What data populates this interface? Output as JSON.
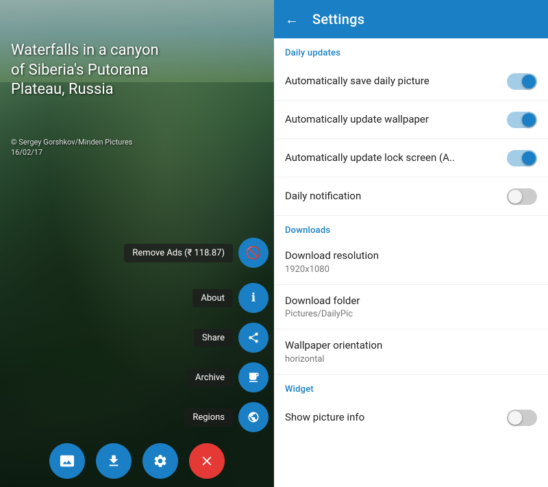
{
  "left": {
    "title": "Waterfalls in a canyon of Siberia's Putorana Plateau, Russia",
    "copyright": "© Sergey Gorshkov/Minden Pictures\n16/02/17",
    "remove_ads_label": "Remove Ads (₹ 118.87)",
    "fab_items": [
      {
        "label": "About",
        "icon": "ℹ"
      },
      {
        "label": "Share",
        "icon": "◁"
      },
      {
        "label": "Archive",
        "icon": "📅"
      },
      {
        "label": "Regions",
        "icon": "🌐"
      }
    ],
    "bottom_buttons": [
      {
        "name": "wallpaper-icon",
        "icon": "⊞",
        "color": "blue"
      },
      {
        "name": "download-icon",
        "icon": "↓",
        "color": "blue"
      },
      {
        "name": "settings-icon",
        "icon": "⚙",
        "color": "blue"
      },
      {
        "name": "close-icon",
        "icon": "✕",
        "color": "red"
      }
    ]
  },
  "right": {
    "header": {
      "back_label": "←",
      "title": "Settings"
    },
    "sections": [
      {
        "id": "daily-updates",
        "label": "Daily updates",
        "items": [
          {
            "id": "auto-save",
            "title": "Automatically save daily picture",
            "subtitle": "",
            "toggle": "on"
          },
          {
            "id": "auto-wallpaper",
            "title": "Automatically update wallpaper",
            "subtitle": "",
            "toggle": "on"
          },
          {
            "id": "auto-lock",
            "title": "Automatically update lock screen (A..",
            "subtitle": "",
            "toggle": "on"
          },
          {
            "id": "daily-notification",
            "title": "Daily notification",
            "subtitle": "",
            "toggle": "off"
          }
        ]
      },
      {
        "id": "downloads",
        "label": "Downloads",
        "items": [
          {
            "id": "download-resolution",
            "title": "Download resolution",
            "subtitle": "1920x1080",
            "toggle": null
          },
          {
            "id": "download-folder",
            "title": "Download folder",
            "subtitle": "Pictures/DailyPic",
            "toggle": null
          },
          {
            "id": "wallpaper-orientation",
            "title": "Wallpaper orientation",
            "subtitle": "horizontal",
            "toggle": null
          }
        ]
      },
      {
        "id": "widget",
        "label": "Widget",
        "items": [
          {
            "id": "show-picture-info",
            "title": "Show picture info",
            "subtitle": "",
            "toggle": "off"
          }
        ]
      }
    ]
  },
  "colors": {
    "accent": "#1a7fc4",
    "toggle_on_bg": "rgba(26,127,196,0.4)",
    "toggle_off_bg": "rgba(0,0,0,0.2)"
  }
}
